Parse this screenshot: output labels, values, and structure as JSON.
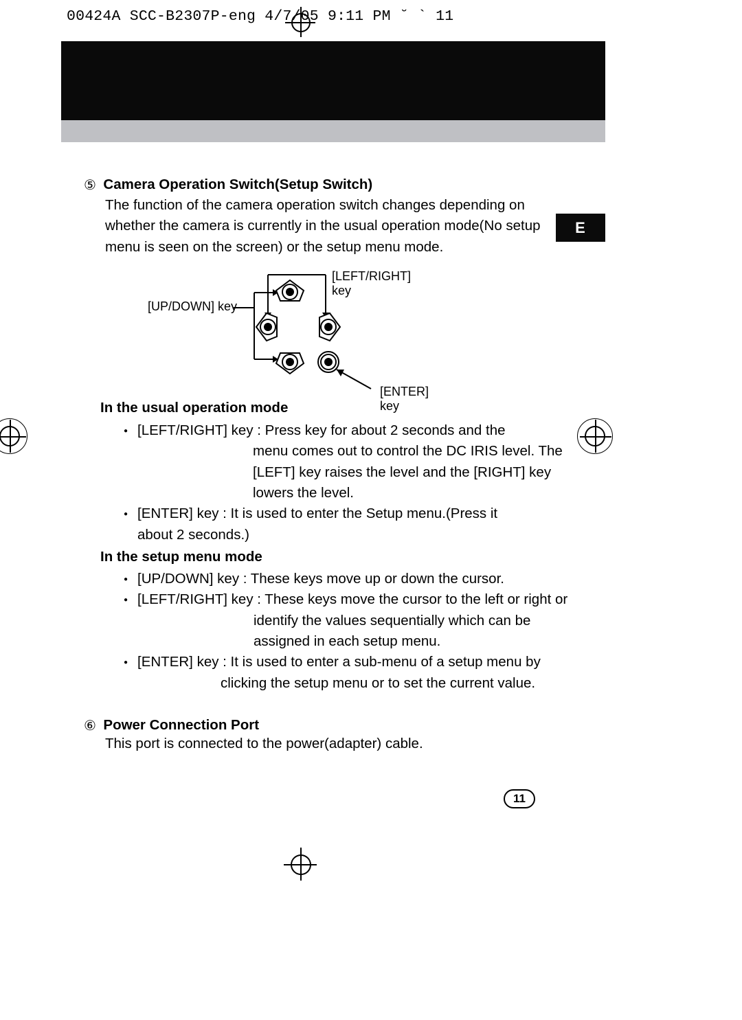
{
  "header": {
    "stamp": "00424A SCC-B2307P-eng  4/7/05 9:11 PM  ˘   `  11"
  },
  "lang_tab": "E",
  "section5": {
    "marker": "⑤",
    "title": "Camera Operation Switch(Setup Switch)",
    "para": "The function of the camera operation switch changes depending on whether the camera is currently in the usual operation mode(No setup menu is seen on the screen) or the setup menu mode."
  },
  "diagram": {
    "up_down_label": "[UP/DOWN] key",
    "left_right_label": "[LEFT/RIGHT] key",
    "enter_label": "[ENTER] key"
  },
  "usual_mode": {
    "heading": "In the usual operation mode",
    "item1_lead": "[LEFT/RIGHT] key : Press key for about 2 seconds and the",
    "item1_wrap": "menu comes out to control the DC IRIS level. The [LEFT] key raises the level and the [RIGHT] key lowers the level.",
    "item2": "[ENTER] key : It is used to enter the Setup menu.(Press it about 2 seconds.)"
  },
  "setup_mode": {
    "heading": "In the setup menu mode",
    "item1": "[UP/DOWN] key : These keys move up or down the cursor.",
    "item2_lead": "[LEFT/RIGHT] key : These keys move the cursor to the left or right or",
    "item2_wrap": "identify the values sequentially which can be assigned in each setup menu.",
    "item3_lead": "[ENTER] key : It is used to enter a sub-menu of a setup menu by",
    "item3_wrap": "clicking the setup menu or to set the current value."
  },
  "section6": {
    "marker": "⑥",
    "title": "Power Connection Port",
    "para": "This port is connected to the power(adapter) cable."
  },
  "page_number": "11"
}
